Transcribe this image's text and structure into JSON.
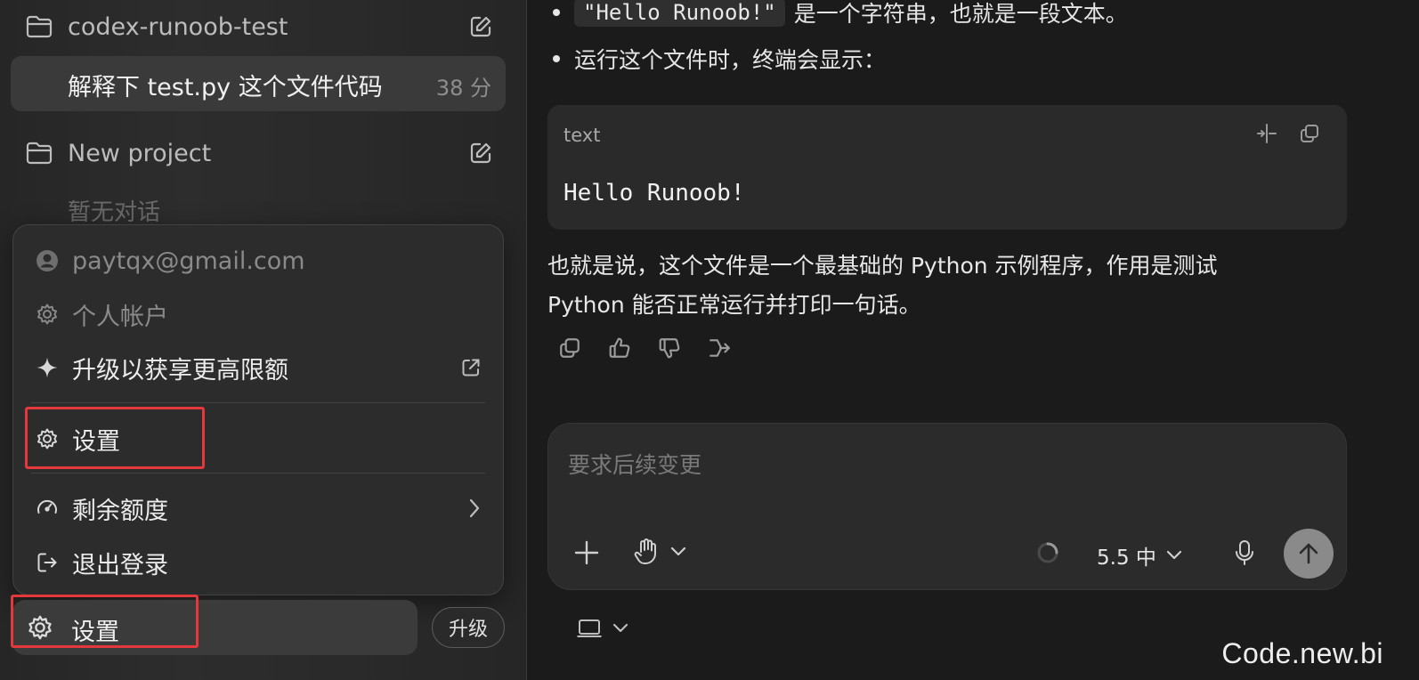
{
  "sidebar": {
    "projects": [
      {
        "name": "codex-runoob-test",
        "icon": "folder-icon",
        "edit_icon": "compose-icon"
      },
      {
        "name": "New project",
        "icon": "folder-icon",
        "edit_icon": "compose-icon"
      }
    ],
    "active_thread": {
      "title": "解释下 test.py 这个文件代码",
      "time": "38 分"
    },
    "empty_note": "暂无对话",
    "popup": {
      "email": "paytqx@gmail.com",
      "items": [
        {
          "label": "个人帐户",
          "icon": "gear-icon"
        },
        {
          "label": "升级以获享更高限额",
          "icon": "sparkle-icon",
          "right_icon": "external-link-icon"
        },
        {
          "label": "设置",
          "icon": "gear-icon"
        },
        {
          "label": "剩余额度",
          "icon": "gauge-icon",
          "right_icon": "chevron-right-icon"
        },
        {
          "label": "退出登录",
          "icon": "logout-icon"
        }
      ]
    },
    "bottom": {
      "settings_label": "设置",
      "upgrade_label": "升级"
    },
    "highlight_color": "#e5383b"
  },
  "chat": {
    "bullets": [
      {
        "code": "\"Hello Runoob!\"",
        "text": "是一个字符串，也就是一段文本。"
      },
      {
        "text": "运行这个文件时，终端会显示："
      }
    ],
    "code_block": {
      "lang": "text",
      "content": "Hello Runoob!"
    },
    "paragraph_line1": "也就是说，这个文件是一个最基础的 Python 示例程序，作用是测试",
    "paragraph_line2": "Python 能否正常运行并打印一句话。",
    "message_actions": [
      "copy-icon",
      "thumbs-up-icon",
      "thumbs-down-icon",
      "share-icon"
    ]
  },
  "composer": {
    "placeholder": "要求后续变更",
    "model": "5.5 中",
    "buttons": [
      "plus-icon",
      "hand-icon",
      "loading-spinner-icon",
      "microphone-icon",
      "send-arrow-icon"
    ]
  },
  "footer": {
    "device_icon": "laptop-icon"
  },
  "watermark": "Code.new.bi"
}
